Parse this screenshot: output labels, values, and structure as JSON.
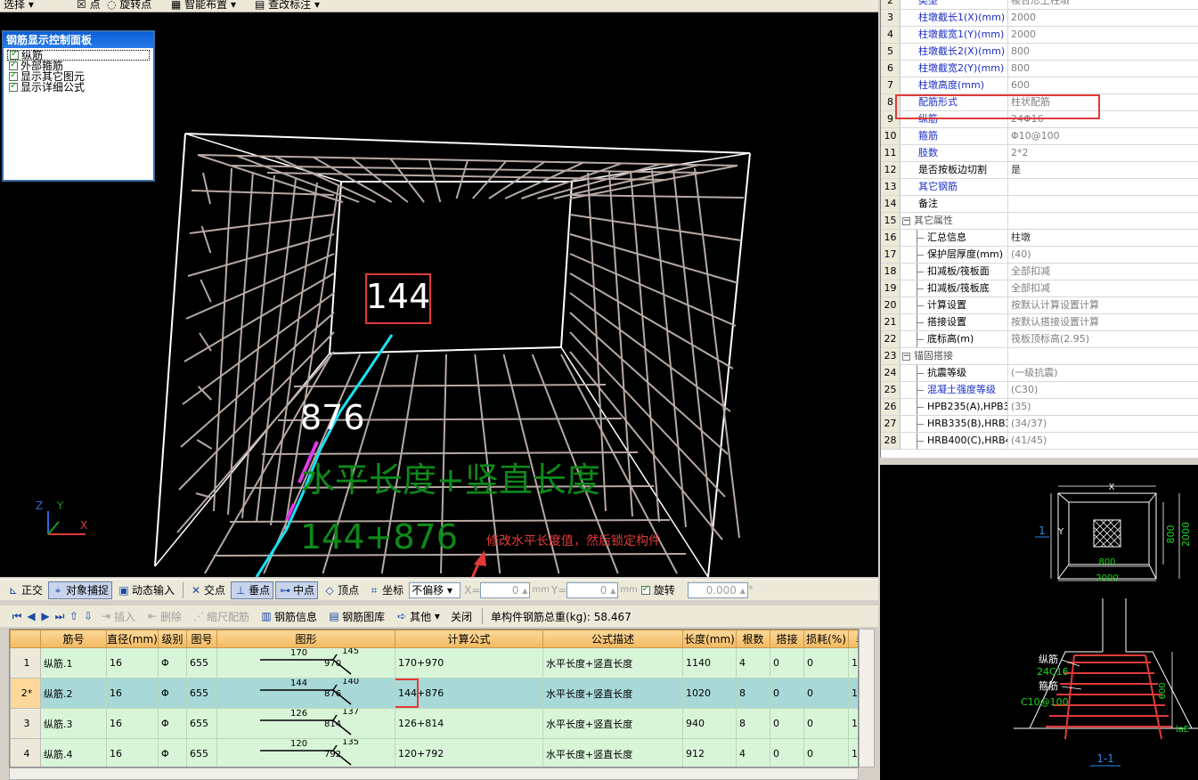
{
  "top_toolbar": {
    "select_label": "选择",
    "point_label": "点",
    "rotate_point_label": "旋转点",
    "smart_layout_label": "智能布置",
    "find_label": "查改标注"
  },
  "control_panel": {
    "title": "钢筋显示控制面板",
    "items": [
      "纵筋",
      "外部箍筋",
      "显示其它图元",
      "显示详细公式"
    ]
  },
  "viewport": {
    "label_144": "144",
    "label_876": "876",
    "formula_text": "水平长度+竖直长度",
    "formula_value": "144+876",
    "annotation": "修改水平长度值，然后锁定构件",
    "axis_z": "Z",
    "axis_y": "Y",
    "axis_x": "X",
    "colors": {
      "grid_line": "#b7a9a3",
      "box_line": "#ffffff",
      "rebar": "#19e3f3",
      "highlight": "#e23a3a",
      "formula": "#0d8a1a"
    }
  },
  "snap_toolbar": {
    "ortho": "正交",
    "snap": "对象捕捉",
    "dynamic_input": "动态输入",
    "intersection": "交点",
    "perpendicular": "垂点",
    "midpoint": "中点",
    "vertex": "顶点",
    "coordinate": "坐标",
    "offset_select": "不偏移",
    "x_label": "X=",
    "x_value": "0",
    "y_label": "Y=",
    "y_value": "0",
    "unit": "mm",
    "rotate_label": "旋转",
    "rotate_value": "0.000",
    "degree": "°"
  },
  "rebar_toolbar": {
    "insert": "插入",
    "delete": "删除",
    "scale_rebar": "缩尺配筋",
    "rebar_info": "钢筋信息",
    "rebar_library": "钢筋图库",
    "other": "其他",
    "close": "关闭",
    "total_weight": "单构件钢筋总重(kg): 58.467"
  },
  "grid": {
    "headers": [
      "",
      "筋号",
      "直径(mm)",
      "级别",
      "图号",
      "图形",
      "计算公式",
      "公式描述",
      "长度(mm)",
      "根数",
      "搭接",
      "损耗(%)",
      "单"
    ],
    "rows": [
      {
        "num": "1",
        "name": "纵筋.1",
        "dia": "16",
        "grade": "Φ",
        "fig": "655",
        "s_top": "170",
        "s_bottom": "970",
        "s_end": "145",
        "formula": "170+970",
        "desc": "水平长度+竖直长度",
        "length": "1140",
        "count": "4",
        "lap": "0",
        "loss": "0",
        "unit": "1."
      },
      {
        "num": "2*",
        "name": "纵筋.2",
        "dia": "16",
        "grade": "Φ",
        "fig": "655",
        "s_top": "144",
        "s_bottom": "876",
        "s_end": "140",
        "formula": "144+876",
        "desc": "水平长度+竖直长度",
        "length": "1020",
        "count": "8",
        "lap": "0",
        "loss": "0",
        "unit": "1."
      },
      {
        "num": "3",
        "name": "纵筋.3",
        "dia": "16",
        "grade": "Φ",
        "fig": "655",
        "s_top": "126",
        "s_bottom": "814",
        "s_end": "137",
        "formula": "126+814",
        "desc": "水平长度+竖直长度",
        "length": "940",
        "count": "8",
        "lap": "0",
        "loss": "0",
        "unit": "1."
      },
      {
        "num": "4",
        "name": "纵筋.4",
        "dia": "16",
        "grade": "Φ",
        "fig": "655",
        "s_top": "120",
        "s_bottom": "792",
        "s_end": "135",
        "formula": "120+792",
        "desc": "水平长度+竖直长度",
        "length": "912",
        "count": "4",
        "lap": "0",
        "loss": "0",
        "unit": "1."
      }
    ]
  },
  "properties": {
    "rows": [
      {
        "n": "2",
        "name": "类型",
        "value": "棱台形上柱墩",
        "style": "blue"
      },
      {
        "n": "3",
        "name": "柱墩截长1(X)(mm)",
        "value": "2000",
        "style": "blue"
      },
      {
        "n": "4",
        "name": "柱墩截宽1(Y)(mm)",
        "value": "2000",
        "style": "blue"
      },
      {
        "n": "5",
        "name": "柱墩截长2(X)(mm)",
        "value": "800",
        "style": "blue"
      },
      {
        "n": "6",
        "name": "柱墩截宽2(Y)(mm)",
        "value": "800",
        "style": "blue"
      },
      {
        "n": "7",
        "name": "柱墩高度(mm)",
        "value": "600",
        "style": "blue"
      },
      {
        "n": "8",
        "name": "配筋形式",
        "value": "柱状配筋",
        "style": "blue"
      },
      {
        "n": "9",
        "name": "纵筋",
        "value": "24Φ16",
        "style": "blue"
      },
      {
        "n": "10",
        "name": "箍筋",
        "value": "Φ10@100",
        "style": "blue"
      },
      {
        "n": "11",
        "name": "肢数",
        "value": "2*2",
        "style": "blue"
      },
      {
        "n": "12",
        "name": "是否按板边切割",
        "value": "是",
        "style": "plain"
      },
      {
        "n": "13",
        "name": "其它钢筋",
        "value": "",
        "style": "blue"
      },
      {
        "n": "14",
        "name": "备注",
        "value": "",
        "style": "plain"
      },
      {
        "n": "15",
        "name": "其它属性",
        "value": "",
        "style": "group"
      },
      {
        "n": "16",
        "name": "汇总信息",
        "value": "柱墩",
        "style": "sub"
      },
      {
        "n": "17",
        "name": "保护层厚度(mm)",
        "value": "(40)",
        "style": "sub"
      },
      {
        "n": "18",
        "name": "扣减板/筏板面",
        "value": "全部扣减",
        "style": "sub"
      },
      {
        "n": "19",
        "name": "扣减板/筏板底",
        "value": "全部扣减",
        "style": "sub"
      },
      {
        "n": "20",
        "name": "计算设置",
        "value": "按默认计算设置计算",
        "style": "sub"
      },
      {
        "n": "21",
        "name": "搭接设置",
        "value": "按默认搭接设置计算",
        "style": "sub"
      },
      {
        "n": "22",
        "name": "底标高(m)",
        "value": "筏板顶标高(2.95)",
        "style": "sub"
      },
      {
        "n": "23",
        "name": "锚固搭接",
        "value": "",
        "style": "group"
      },
      {
        "n": "24",
        "name": "抗震等级",
        "value": "(一级抗震)",
        "style": "sub"
      },
      {
        "n": "25",
        "name": "混凝土强度等级",
        "value": "(C30)",
        "style": "subblue"
      },
      {
        "n": "26",
        "name": "HPB235(A),HPB3",
        "value": "(35)",
        "style": "sub"
      },
      {
        "n": "27",
        "name": "HRB335(B),HRB3",
        "value": "(34/37)",
        "style": "sub"
      },
      {
        "n": "28",
        "name": "HRB400(C),HRB4",
        "value": "(41/45)",
        "style": "sub"
      }
    ]
  },
  "drawing": {
    "dim_x": "X",
    "dim_y": "Y",
    "dim_800_v": "800",
    "dim_2000_v": "2000",
    "dim_800_h": "800",
    "dim_2000_h": "2000",
    "section_mark": "1",
    "long_rebar_label": "纵筋",
    "long_rebar_value": "24C16",
    "stirrup_label": "箍筋",
    "stirrup_value": "C10@100",
    "height_dim": "600",
    "lae": "laE",
    "section_title": "1-1"
  }
}
